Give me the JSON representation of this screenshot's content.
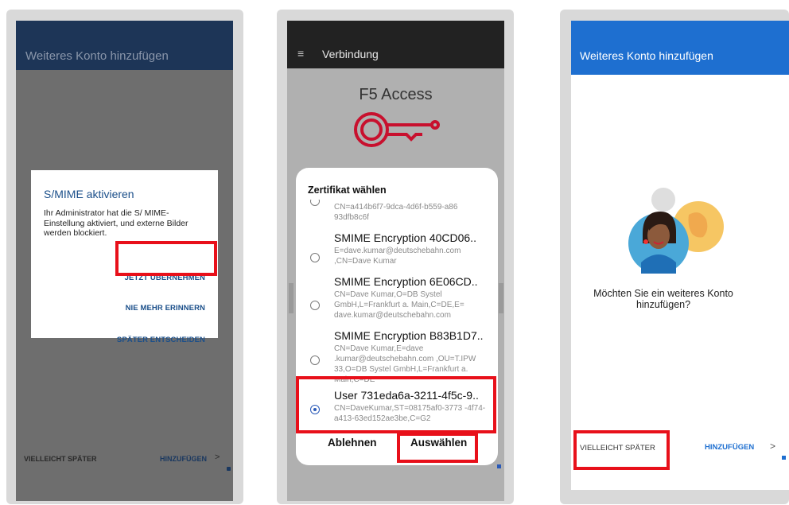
{
  "panel1": {
    "app_title": "Weiteres Konto hinzufügen",
    "dialog": {
      "title": "S/MIME aktivieren",
      "body": "Ihr Administrator hat die S/ MIME-Einstellung aktiviert, und externe Bilder werden blockiert.",
      "actions": [
        "JETZT ÜBERNEHMEN",
        "NIE MEHR ERINNERN",
        "SPÄTER ENTSCHEIDEN"
      ]
    },
    "bottom": {
      "later": "VIELLEICHT SPÄTER",
      "add": "HINZUFÜGEN",
      "chevron": ">"
    }
  },
  "panel2": {
    "menu_icon": "≡",
    "title": "Verbindung",
    "app_name": "F5 Access",
    "sheet": {
      "title": "Zertifikat wählen",
      "items": [
        {
          "name": "",
          "detail": "CN=a414b6f7-9dca-4d6f-b559-a86 93dfb8c6f",
          "selected": false
        },
        {
          "name": "SMIME Encryption 40CD06..",
          "detail": "E=dave.kumar@deutschebahn.com ,CN=Dave Kumar",
          "selected": false
        },
        {
          "name": "SMIME Encryption 6E06CD..",
          "detail": "CN=Dave Kumar,O=DB Systel GmbH,L=Frankfurt a. Main,C=DE,E= dave.kumar@deutschebahn.com",
          "selected": false
        },
        {
          "name": "SMIME Encryption B83B1D7..",
          "detail": "CN=Dave Kumar,E=dave .kumar@deutschebahn.com ,OU=T.IPW 33,O=DB Systel GmbH,L=Frankfurt a. Main,C=DE",
          "selected": false
        },
        {
          "name": "User 731eda6a-3211-4f5c-9..",
          "detail": "CN=DaveKumar,ST=08175af0-3773 -4f74-a413-63ed152ae3be,C=G2",
          "selected": true
        }
      ],
      "reject": "Ablehnen",
      "select": "Auswählen"
    }
  },
  "panel3": {
    "app_title": "Weiteres Konto hinzufügen",
    "question": "Möchten Sie ein weiteres Konto hinzufügen?",
    "bottom": {
      "later": "VIELLEICHT SPÄTER",
      "add": "HINZUFÜGEN",
      "chevron": ">"
    }
  },
  "colors": {
    "highlight": "#e8101a",
    "outlook_blue": "#1e6fd0",
    "dialog_accent": "#1b4f8a",
    "f5_red": "#c8102e"
  }
}
